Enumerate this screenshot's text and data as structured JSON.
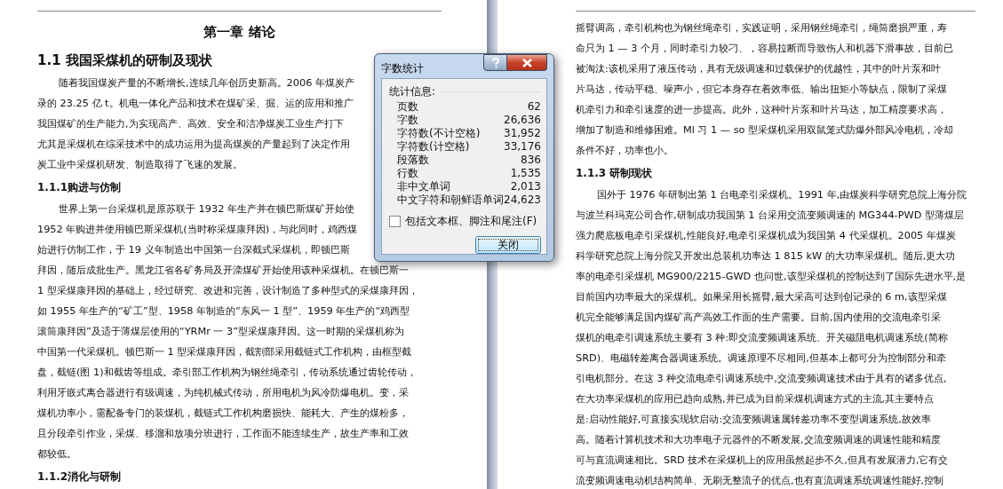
{
  "left_page": {
    "chapter_title": "第一章 绪论",
    "section_title": "1.1 我国采煤机的研制及现状",
    "blocks": [
      {
        "kind": "paragraph",
        "indent": true,
        "lines": [
          "随着我国煤炭产量的不断增长,连续几年创历史新高。2006 年煤炭产",
          "录的 23.25 亿 t。机电一体化产品和技术在煤矿采、掘、运的应用和推广",
          "我国煤矿的生产能力,为实现高产、高效、安全和洁净煤炭工业生产打下",
          "尤其是采煤机在综采技术中的成功运用为提高煤炭的产量起到了决定作用",
          "炭工业中采煤机研发、制造取得了飞速的发展。"
        ]
      },
      {
        "kind": "heading",
        "text": "1.1.1购进与仿制"
      },
      {
        "kind": "paragraph",
        "indent": true,
        "lines": [
          "世界上第一台采煤机是原苏联于 1932 年生产并在顿巴斯煤矿开始使",
          "1952 年购进并使用顿巴斯采煤机(当时称采煤康拜因)，与此同时，鸡西煤",
          "始进行仿制工作，于 19 义年制造出中国第一台深截式采煤机，即顿巴斯",
          "拜因，随后成批生产。黑龙江省各矿务局及开滦煤矿开始使用该种采煤机。在顿巴斯一",
          "1 型采煤康拜因的基础上，经过研究、改进和完善，设计制造了多种型式的采煤康拜因，",
          "如 1955 年生产的“矿工”型、1958 年制造的“东风一 1 型”、1959 年生产的“鸡西型",
          "滚筒康拜因”及适于薄煤层使用的“YRMr 一 3”型采煤康拜因。这一时期的采煤机称为",
          "中国第一代采煤机。顿巴斯一 1 型采煤康拜因，截割部采用截链式工作机构，由框型截",
          "盘，截链(图 1)和截齿等组成。牵引部工作机构为钢丝绳牵引，传动系统通过齿轮传动，",
          "利用牙嵌式离合器进行有级调速，为纯机械式传动，所用电机为风冷防爆电机。变，采",
          "煤机功率小，需配备专门的装煤机，截链式工作机构磨损快、能耗大、产生的煤粉多，",
          "且分段牵引作业，采煤、移溜和放项分班进行，工作面不能连续生产，故生产率和工效",
          "都较低。"
        ]
      },
      {
        "kind": "heading",
        "text": "1.1.2消化与研制"
      }
    ]
  },
  "right_page": {
    "blocks": [
      {
        "kind": "paragraph",
        "indent": false,
        "lines": [
          "摇臂调高，牵引机构也为钢丝绳牵引，实践证明，采用钢丝绳牵引，绳筒磨损严重，寿",
          "命只为 1 — 3 个月，同时牵引力较刁、，容易拉断而导致伤人和机器下滑事故，目前已",
          "被淘汰:该机采用了液压传动，具有无级调速和过载保护的优越性，其中的叶片泵和叶",
          "片马达，传动平稳、噪声小，但它本身存在着效率低、输出扭矩小等缺点，限制了采煤",
          "机牵引力和牵引速度的进一步提高。此外，这种叶片泵和叶片马达，加工精度要求高，",
          "增加了制造和维修困难。Ml 习 1 — so 型采煤机采用双鼠笼式防爆外部风冷电机，冷却",
          "条件不好，功率也小。"
        ]
      },
      {
        "kind": "heading",
        "text": "1.1.3 研制现状"
      },
      {
        "kind": "paragraph",
        "indent": true,
        "lines": [
          "国外于 1976 年研制出第 1 台电牵引采煤机。1991 年,由煤炭科学研究总院上海分院",
          "与波兰科玛克公司合作,研制成功我国第 1 台采用交流变频调速的 MG344-PWD 型薄煤层",
          "强力爬底板电牵引采煤机,性能良好,电牵引采煤机成为我国第 4 代采煤机。2005 年煤炭",
          "科学研究总院上海分院又开发出总装机功率达 1 815 kW 的大功率采煤机。随后,更大功",
          "率的电牵引采煤机 MG900/2215-GWD 也问世,该型采煤机的控制达到了国际先进水平,是",
          "目前国内功率最大的采煤机。如果采用长摇臂,最大采高可达到创记录的 6 m,该型采煤",
          "机完全能够满足国内煤矿高产高效工作面的生产需要。目前,国内使用的交流电牵引采",
          "煤机的电牵引调速系统主要有 3 种:即交流变频调速系统、开关磁阻电机调速系统(简称",
          "SRD)、电磁转差离合器调速系统。调速原理不尽相同,但基本上都可分为控制部分和牵",
          "引电机部分。在这 3 种交流电牵引调速系统中,交流变频调速技术由于具有的诸多优点,",
          "在大功率采煤机的应用已趋向成熟,并已成为目前采煤机调速方式的主流,其主要特点",
          "是:启动性能好,可直接实现软启动:交流变频调速属转差功率不变型调速系统,故效率",
          "高。随着计算机技术和大功率电子元器件的不断发展,交流变频调速的调速性能和精度",
          "可与直流调速相比。SRD 技术在采煤机上的应用虽然起步不久,但具有发展潜力,它有交",
          "流变频调速电动机结构简单、无刷无整流子的优点,也有直流调速系统调速性能好,控制"
        ]
      }
    ]
  },
  "dialog": {
    "title": "字数统计",
    "group_label": "统计信息:",
    "stats": [
      {
        "label": "页数",
        "value": "62"
      },
      {
        "label": "字数",
        "value": "26,636"
      },
      {
        "label": "字符数(不计空格)",
        "value": "31,952"
      },
      {
        "label": "字符数(计空格)",
        "value": "33,176"
      },
      {
        "label": "段落数",
        "value": "836"
      },
      {
        "label": "行数",
        "value": "1,535"
      },
      {
        "label": "非中文单词",
        "value": "2,013"
      },
      {
        "label": "中文字符和朝鲜语单词",
        "value": "24,623"
      }
    ],
    "checkbox": {
      "label": "包括文本框、脚注和尾注(F)",
      "checked": false
    },
    "close_button": "关闭"
  }
}
